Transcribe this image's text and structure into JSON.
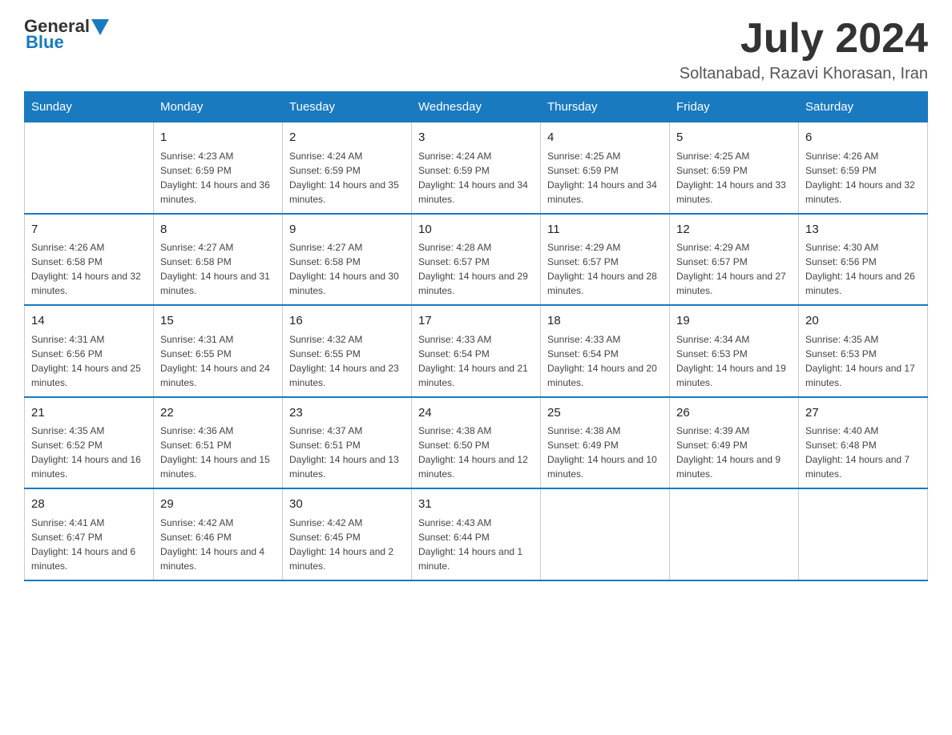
{
  "header": {
    "logo": {
      "general": "General",
      "blue": "Blue"
    },
    "title": "July 2024",
    "location": "Soltanabad, Razavi Khorasan, Iran"
  },
  "weekdays": [
    "Sunday",
    "Monday",
    "Tuesday",
    "Wednesday",
    "Thursday",
    "Friday",
    "Saturday"
  ],
  "weeks": [
    [
      {
        "day": "",
        "sunrise": "",
        "sunset": "",
        "daylight": ""
      },
      {
        "day": "1",
        "sunrise": "Sunrise: 4:23 AM",
        "sunset": "Sunset: 6:59 PM",
        "daylight": "Daylight: 14 hours and 36 minutes."
      },
      {
        "day": "2",
        "sunrise": "Sunrise: 4:24 AM",
        "sunset": "Sunset: 6:59 PM",
        "daylight": "Daylight: 14 hours and 35 minutes."
      },
      {
        "day": "3",
        "sunrise": "Sunrise: 4:24 AM",
        "sunset": "Sunset: 6:59 PM",
        "daylight": "Daylight: 14 hours and 34 minutes."
      },
      {
        "day": "4",
        "sunrise": "Sunrise: 4:25 AM",
        "sunset": "Sunset: 6:59 PM",
        "daylight": "Daylight: 14 hours and 34 minutes."
      },
      {
        "day": "5",
        "sunrise": "Sunrise: 4:25 AM",
        "sunset": "Sunset: 6:59 PM",
        "daylight": "Daylight: 14 hours and 33 minutes."
      },
      {
        "day": "6",
        "sunrise": "Sunrise: 4:26 AM",
        "sunset": "Sunset: 6:59 PM",
        "daylight": "Daylight: 14 hours and 32 minutes."
      }
    ],
    [
      {
        "day": "7",
        "sunrise": "Sunrise: 4:26 AM",
        "sunset": "Sunset: 6:58 PM",
        "daylight": "Daylight: 14 hours and 32 minutes."
      },
      {
        "day": "8",
        "sunrise": "Sunrise: 4:27 AM",
        "sunset": "Sunset: 6:58 PM",
        "daylight": "Daylight: 14 hours and 31 minutes."
      },
      {
        "day": "9",
        "sunrise": "Sunrise: 4:27 AM",
        "sunset": "Sunset: 6:58 PM",
        "daylight": "Daylight: 14 hours and 30 minutes."
      },
      {
        "day": "10",
        "sunrise": "Sunrise: 4:28 AM",
        "sunset": "Sunset: 6:57 PM",
        "daylight": "Daylight: 14 hours and 29 minutes."
      },
      {
        "day": "11",
        "sunrise": "Sunrise: 4:29 AM",
        "sunset": "Sunset: 6:57 PM",
        "daylight": "Daylight: 14 hours and 28 minutes."
      },
      {
        "day": "12",
        "sunrise": "Sunrise: 4:29 AM",
        "sunset": "Sunset: 6:57 PM",
        "daylight": "Daylight: 14 hours and 27 minutes."
      },
      {
        "day": "13",
        "sunrise": "Sunrise: 4:30 AM",
        "sunset": "Sunset: 6:56 PM",
        "daylight": "Daylight: 14 hours and 26 minutes."
      }
    ],
    [
      {
        "day": "14",
        "sunrise": "Sunrise: 4:31 AM",
        "sunset": "Sunset: 6:56 PM",
        "daylight": "Daylight: 14 hours and 25 minutes."
      },
      {
        "day": "15",
        "sunrise": "Sunrise: 4:31 AM",
        "sunset": "Sunset: 6:55 PM",
        "daylight": "Daylight: 14 hours and 24 minutes."
      },
      {
        "day": "16",
        "sunrise": "Sunrise: 4:32 AM",
        "sunset": "Sunset: 6:55 PM",
        "daylight": "Daylight: 14 hours and 23 minutes."
      },
      {
        "day": "17",
        "sunrise": "Sunrise: 4:33 AM",
        "sunset": "Sunset: 6:54 PM",
        "daylight": "Daylight: 14 hours and 21 minutes."
      },
      {
        "day": "18",
        "sunrise": "Sunrise: 4:33 AM",
        "sunset": "Sunset: 6:54 PM",
        "daylight": "Daylight: 14 hours and 20 minutes."
      },
      {
        "day": "19",
        "sunrise": "Sunrise: 4:34 AM",
        "sunset": "Sunset: 6:53 PM",
        "daylight": "Daylight: 14 hours and 19 minutes."
      },
      {
        "day": "20",
        "sunrise": "Sunrise: 4:35 AM",
        "sunset": "Sunset: 6:53 PM",
        "daylight": "Daylight: 14 hours and 17 minutes."
      }
    ],
    [
      {
        "day": "21",
        "sunrise": "Sunrise: 4:35 AM",
        "sunset": "Sunset: 6:52 PM",
        "daylight": "Daylight: 14 hours and 16 minutes."
      },
      {
        "day": "22",
        "sunrise": "Sunrise: 4:36 AM",
        "sunset": "Sunset: 6:51 PM",
        "daylight": "Daylight: 14 hours and 15 minutes."
      },
      {
        "day": "23",
        "sunrise": "Sunrise: 4:37 AM",
        "sunset": "Sunset: 6:51 PM",
        "daylight": "Daylight: 14 hours and 13 minutes."
      },
      {
        "day": "24",
        "sunrise": "Sunrise: 4:38 AM",
        "sunset": "Sunset: 6:50 PM",
        "daylight": "Daylight: 14 hours and 12 minutes."
      },
      {
        "day": "25",
        "sunrise": "Sunrise: 4:38 AM",
        "sunset": "Sunset: 6:49 PM",
        "daylight": "Daylight: 14 hours and 10 minutes."
      },
      {
        "day": "26",
        "sunrise": "Sunrise: 4:39 AM",
        "sunset": "Sunset: 6:49 PM",
        "daylight": "Daylight: 14 hours and 9 minutes."
      },
      {
        "day": "27",
        "sunrise": "Sunrise: 4:40 AM",
        "sunset": "Sunset: 6:48 PM",
        "daylight": "Daylight: 14 hours and 7 minutes."
      }
    ],
    [
      {
        "day": "28",
        "sunrise": "Sunrise: 4:41 AM",
        "sunset": "Sunset: 6:47 PM",
        "daylight": "Daylight: 14 hours and 6 minutes."
      },
      {
        "day": "29",
        "sunrise": "Sunrise: 4:42 AM",
        "sunset": "Sunset: 6:46 PM",
        "daylight": "Daylight: 14 hours and 4 minutes."
      },
      {
        "day": "30",
        "sunrise": "Sunrise: 4:42 AM",
        "sunset": "Sunset: 6:45 PM",
        "daylight": "Daylight: 14 hours and 2 minutes."
      },
      {
        "day": "31",
        "sunrise": "Sunrise: 4:43 AM",
        "sunset": "Sunset: 6:44 PM",
        "daylight": "Daylight: 14 hours and 1 minute."
      },
      {
        "day": "",
        "sunrise": "",
        "sunset": "",
        "daylight": ""
      },
      {
        "day": "",
        "sunrise": "",
        "sunset": "",
        "daylight": ""
      },
      {
        "day": "",
        "sunrise": "",
        "sunset": "",
        "daylight": ""
      }
    ]
  ]
}
